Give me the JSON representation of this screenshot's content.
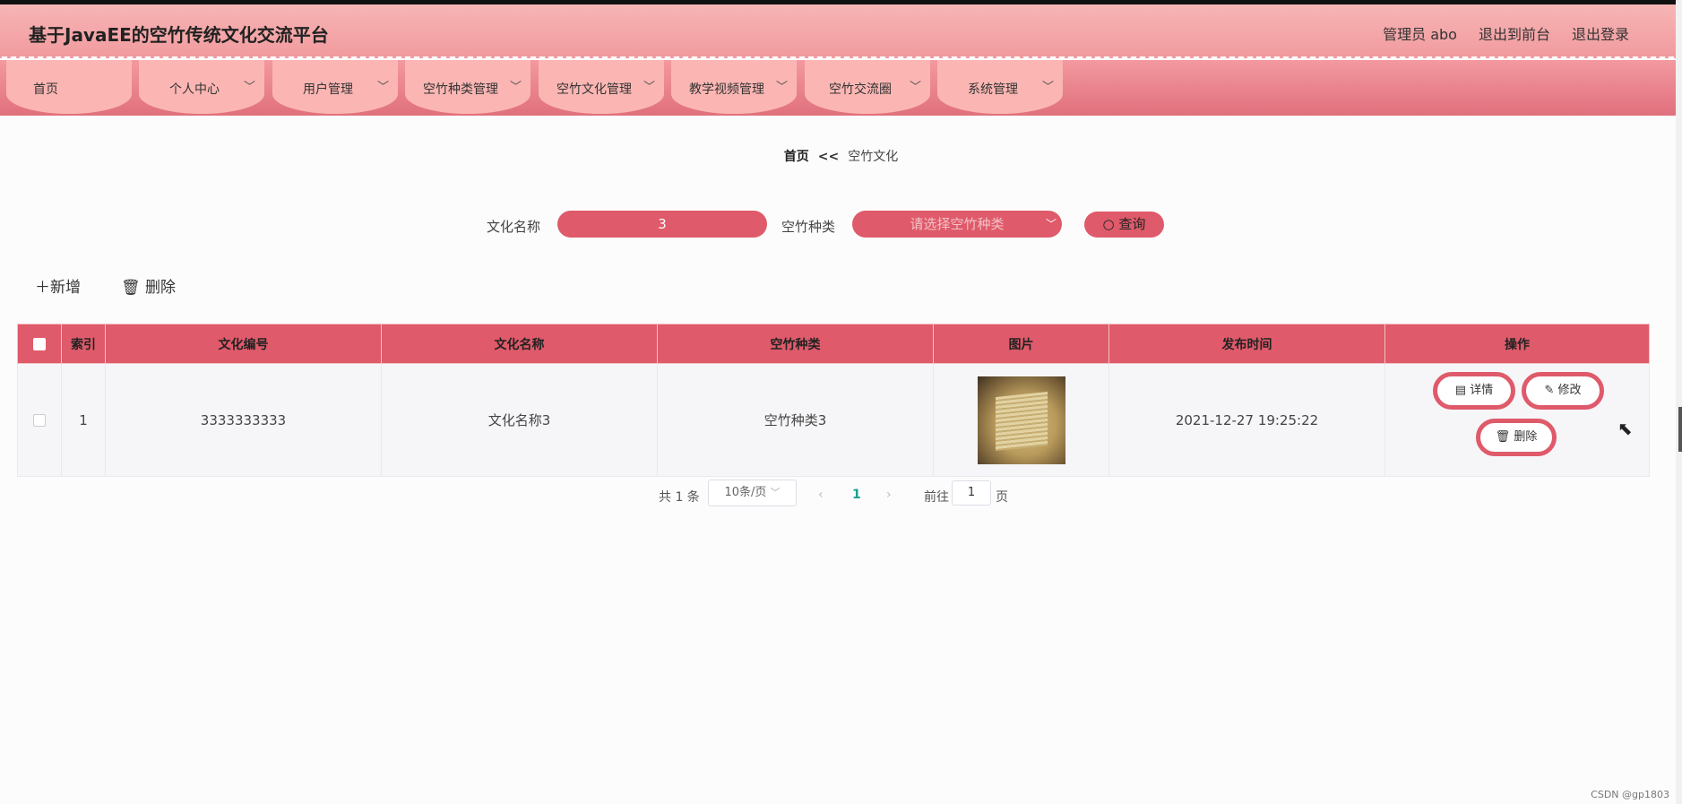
{
  "header": {
    "title": "基于JavaEE的空竹传统文化交流平台",
    "admin": "管理员 abo",
    "to_front": "退出到前台",
    "logout": "退出登录"
  },
  "nav": [
    {
      "label": "首页"
    },
    {
      "label": "个人中心"
    },
    {
      "label": "用户管理"
    },
    {
      "label": "空竹种类管理"
    },
    {
      "label": "空竹文化管理"
    },
    {
      "label": "教学视频管理"
    },
    {
      "label": "空竹交流圈"
    },
    {
      "label": "系统管理"
    }
  ],
  "breadcrumb": {
    "home": "首页",
    "sep": "<<",
    "current": "空竹文化"
  },
  "search": {
    "name_label": "文化名称",
    "name_value": "3",
    "type_label": "空竹种类",
    "type_placeholder": "请选择空竹种类",
    "query_label": "查询"
  },
  "actions": {
    "add": "新增",
    "delete": "删除"
  },
  "table": {
    "headers": [
      "索引",
      "文化编号",
      "文化名称",
      "空竹种类",
      "图片",
      "发布时间",
      "操作"
    ],
    "rows": [
      {
        "index": "1",
        "code": "3333333333",
        "name": "文化名称3",
        "type": "空竹种类3",
        "time": "2021-12-27 19:25:22",
        "btn_detail": "详情",
        "btn_edit": "修改",
        "btn_delete": "删除"
      }
    ]
  },
  "pager": {
    "total": "共 1 条",
    "page_size": "10条/页",
    "current": "1",
    "goto": "前往",
    "goto_value": "1",
    "page_unit": "页"
  },
  "watermark": "CSDN @gp1803",
  "colors": {
    "accent": "#df5a6a",
    "header": "#f19a9e",
    "tab": "#fbb6b3",
    "page_active": "#1aa094"
  }
}
